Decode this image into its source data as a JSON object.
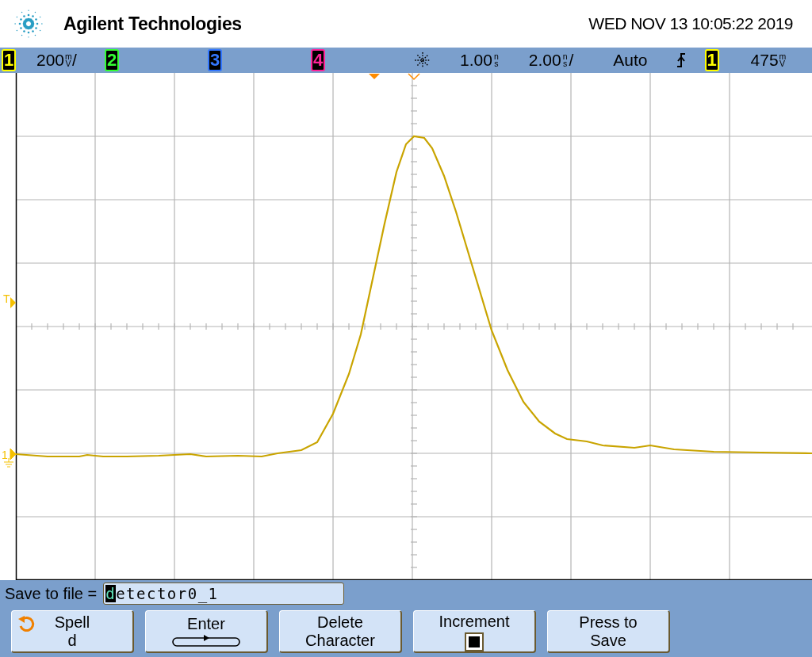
{
  "header": {
    "brand": "Agilent Technologies",
    "datetime": "WED NOV 13 10:05:22 2019"
  },
  "status_bar": {
    "channels": [
      {
        "number": "1",
        "color": "#ffff00",
        "scale": {
          "value": "200",
          "unit": "mV",
          "suffix": "/"
        }
      },
      {
        "number": "2",
        "color": "#33ff33"
      },
      {
        "number": "3",
        "color": "#3377ff"
      },
      {
        "number": "4",
        "color": "#ff2299"
      }
    ],
    "delay": {
      "value": "1.00",
      "unit": "ns"
    },
    "timebase": {
      "value": "2.00",
      "unit": "ns",
      "suffix": "/"
    },
    "trigger_mode": "Auto",
    "trigger_source": {
      "number": "1",
      "color": "#ffff00"
    },
    "trigger_level": {
      "value": "475",
      "unit": "mV"
    }
  },
  "graticule": {
    "trigger_marker": "T",
    "ground_marker": "1"
  },
  "save": {
    "label": "Save to file =",
    "cursor_char": "d",
    "rest": "etector0_1"
  },
  "softkeys": [
    {
      "kind": "spell",
      "lines": [
        "Spell",
        "d"
      ]
    },
    {
      "kind": "enter",
      "lines": [
        "Enter"
      ]
    },
    {
      "kind": "text",
      "lines": [
        "Delete",
        "Character"
      ]
    },
    {
      "kind": "checkbox",
      "lines": [
        "Increment"
      ],
      "checked": true
    },
    {
      "kind": "text",
      "lines": [
        "Press to",
        "Save"
      ]
    }
  ]
}
